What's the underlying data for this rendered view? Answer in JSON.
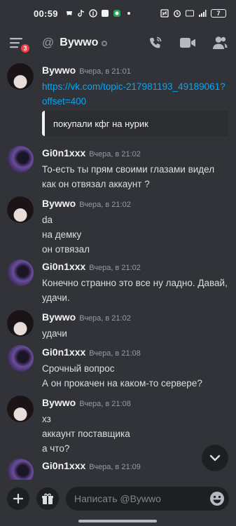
{
  "status_bar": {
    "time": "00:59",
    "battery": "7"
  },
  "header": {
    "menu_badge": "3",
    "title": "Bywwo"
  },
  "messages": [
    {
      "author": "Bywwo",
      "timestamp": "Вчера, в 21:01",
      "link": "https://vk.com/topic-217981193_49189061?offset=400",
      "embed_text": "покупали кфг на нурик"
    },
    {
      "author": "Gi0n1xxx",
      "timestamp": "Вчера, в 21:02",
      "lines": [
        "То-есть ты прям своими глазами видел как он отвязал аккаунт ?"
      ]
    },
    {
      "author": "Bywwo",
      "timestamp": "Вчера, в 21:02",
      "lines": [
        "da",
        "на демку",
        "он отвязал"
      ]
    },
    {
      "author": "Gi0n1xxx",
      "timestamp": "Вчера, в 21:02",
      "lines": [
        "Конечно странно это все ну ладно. Давай, удачи."
      ]
    },
    {
      "author": "Bywwo",
      "timestamp": "Вчера, в 21:02",
      "lines": [
        "удачи"
      ]
    },
    {
      "author": "Gi0n1xxx",
      "timestamp": "Вчера, в 21:08",
      "lines": [
        "Срочный вопрос",
        "А он прокачен на каком-то сервере?"
      ]
    },
    {
      "author": "Bywwo",
      "timestamp": "Вчера, в 21:08",
      "lines": [
        "хз",
        "аккаунт поставщика",
        "а что?"
      ]
    },
    {
      "author": "Gi0n1xxx",
      "timestamp": "Вчера, в 21:09",
      "lines": []
    }
  ],
  "composer": {
    "placeholder": "Написать @Bywwo"
  },
  "icons": {
    "menu": "hamburger-icon",
    "at": "at-icon",
    "call": "phone-icon",
    "video": "video-camera-icon",
    "members": "members-icon",
    "add": "plus-icon",
    "gift": "gift-icon",
    "emoji": "emoji-icon",
    "scroll": "chevron-down-icon"
  },
  "colors": {
    "background": "#313338",
    "link": "#00a8fc",
    "badge": "#f23f43"
  }
}
